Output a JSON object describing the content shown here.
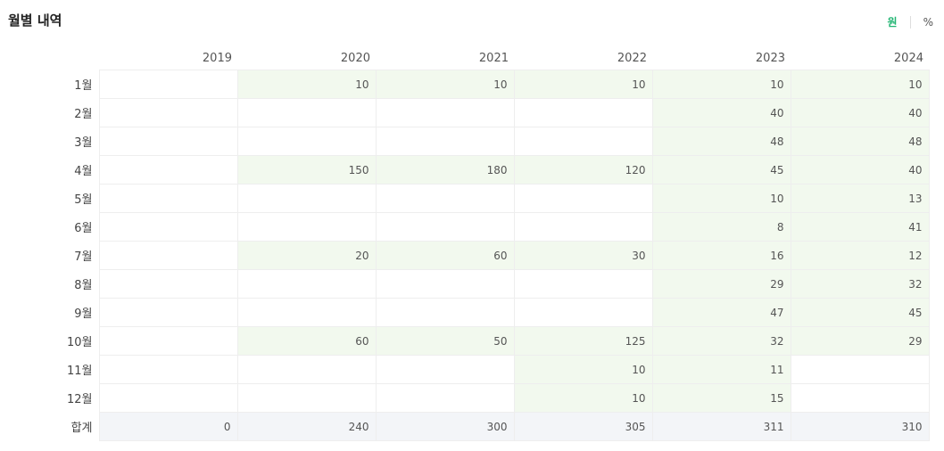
{
  "header": {
    "title": "월별 내역",
    "unit_won": "원",
    "unit_percent": "%"
  },
  "table": {
    "years": [
      "2019",
      "2020",
      "2021",
      "2022",
      "2023",
      "2024"
    ],
    "months": [
      "1월",
      "2월",
      "3월",
      "4월",
      "5월",
      "6월",
      "7월",
      "8월",
      "9월",
      "10월",
      "11월",
      "12월"
    ],
    "values": [
      [
        "",
        "10",
        "10",
        "10",
        "10",
        "10"
      ],
      [
        "",
        "",
        "",
        "",
        "40",
        "40"
      ],
      [
        "",
        "",
        "",
        "",
        "48",
        "48"
      ],
      [
        "",
        "150",
        "180",
        "120",
        "45",
        "40"
      ],
      [
        "",
        "",
        "",
        "",
        "10",
        "13"
      ],
      [
        "",
        "",
        "",
        "",
        "8",
        "41"
      ],
      [
        "",
        "20",
        "60",
        "30",
        "16",
        "12"
      ],
      [
        "",
        "",
        "",
        "",
        "29",
        "32"
      ],
      [
        "",
        "",
        "",
        "",
        "47",
        "45"
      ],
      [
        "",
        "60",
        "50",
        "125",
        "32",
        "29"
      ],
      [
        "",
        "",
        "",
        "10",
        "11",
        ""
      ],
      [
        "",
        "",
        "",
        "10",
        "15",
        ""
      ]
    ],
    "total_label": "합계",
    "totals": [
      "0",
      "240",
      "300",
      "305",
      "311",
      "310"
    ]
  },
  "colors": {
    "accent": "#22b573",
    "filled_cell": "#f2f9ee",
    "total_row": "#f3f5f8"
  }
}
